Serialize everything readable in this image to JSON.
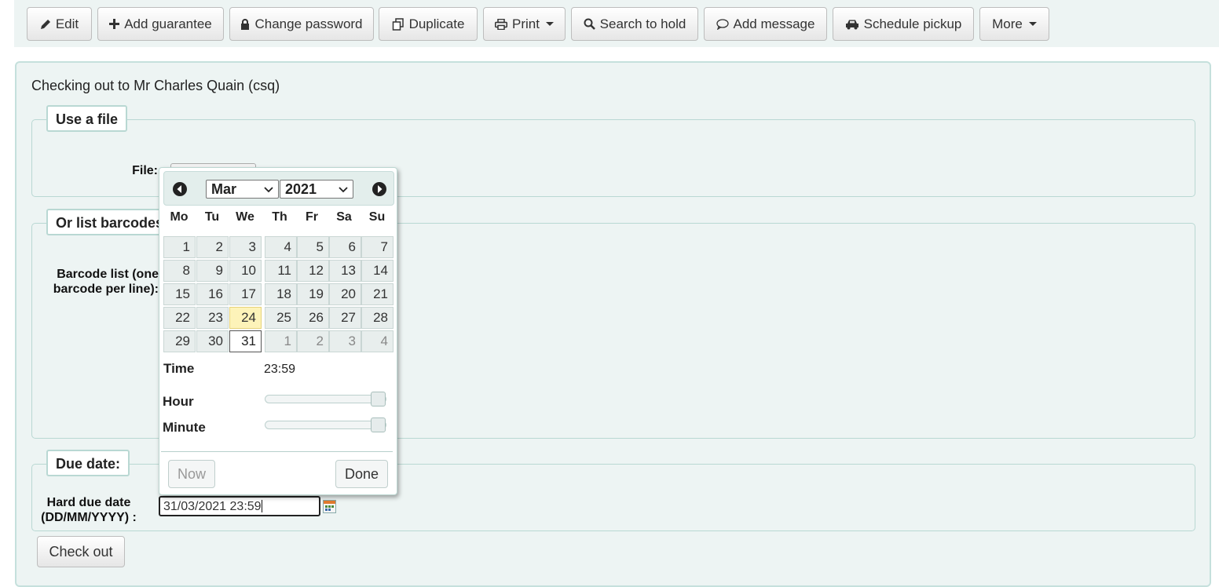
{
  "toolbar": {
    "edit": "Edit",
    "add_guarantee": "Add guarantee",
    "change_password": "Change password",
    "duplicate": "Duplicate",
    "print": "Print",
    "search_to_hold": "Search to hold",
    "add_message": "Add message",
    "schedule_pickup": "Schedule pickup",
    "more": "More"
  },
  "checkout": {
    "title": "Checking out to Mr Charles Quain (csq)",
    "file_section": "Use a file",
    "file_label": "File:",
    "barcode_section": "Or list barcodes",
    "barcode_label_1": "Barcode list (one",
    "barcode_label_2": "barcode per line):",
    "due_section": "Due date:",
    "hard_due_label_1": "Hard due date",
    "hard_due_label_2": "(DD/MM/YYYY) :",
    "due_value": "31/03/2021 23:59",
    "checkout_button": "Check out"
  },
  "datepicker": {
    "month": "Mar",
    "year": "2021",
    "weekdays": [
      "Mo",
      "Tu",
      "We",
      "Th",
      "Fr",
      "Sa",
      "Su"
    ],
    "weeks": [
      [
        "1",
        "2",
        "3",
        "4",
        "5",
        "6",
        "7"
      ],
      [
        "8",
        "9",
        "10",
        "11",
        "12",
        "13",
        "14"
      ],
      [
        "15",
        "16",
        "17",
        "18",
        "19",
        "20",
        "21"
      ],
      [
        "22",
        "23",
        "24",
        "25",
        "26",
        "27",
        "28"
      ],
      [
        "29",
        "30",
        "31",
        "1",
        "2",
        "3",
        "4"
      ]
    ],
    "today": "24",
    "selected": "31",
    "time_label": "Time",
    "time_value": "23:59",
    "hour_label": "Hour",
    "minute_label": "Minute",
    "hour_level": 1.0,
    "minute_level": 1.0,
    "now_button": "Now",
    "done_button": "Done"
  },
  "icons": {
    "edit": "pencil-icon",
    "add_guarantee": "plus-icon",
    "change_password": "lock-icon",
    "duplicate": "copy-icon",
    "print": "print-icon",
    "search_to_hold": "search-icon",
    "add_message": "comment-icon",
    "schedule_pickup": "car-icon",
    "date_input": "calendar-icon"
  },
  "colors": {
    "panel_bg": "#edf4f3",
    "panel_border": "#c5e0dc",
    "today_highlight": "#fdf3b9"
  }
}
